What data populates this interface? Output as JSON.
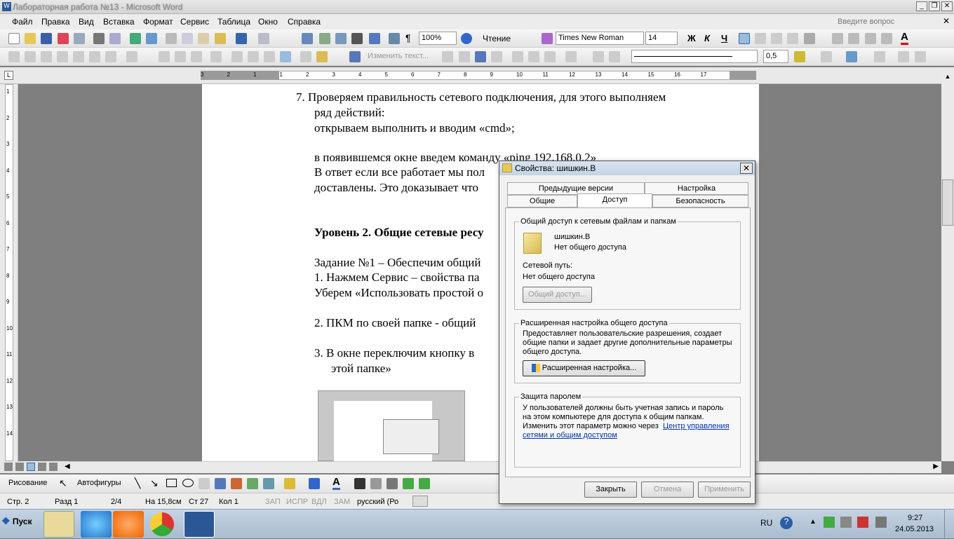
{
  "window": {
    "title": "Лабораторная работа №13 - Microsoft Word"
  },
  "menu": {
    "items": [
      "Файл",
      "Правка",
      "Вид",
      "Вставка",
      "Формат",
      "Сервис",
      "Таблица",
      "Окно",
      "Справка"
    ],
    "help_placeholder": "Введите вопрос"
  },
  "toolbar": {
    "zoom": "100%",
    "reading": "Чтение",
    "font": "Times New Roman",
    "size": "14",
    "bold": "Ж",
    "italic": "К",
    "underline": "Ч",
    "change_text": "Изменить текст...",
    "line_width": "0,5"
  },
  "ruler": {
    "marks": [
      "3",
      "2",
      "1",
      "1",
      "2",
      "3",
      "4",
      "5",
      "6",
      "7",
      "8",
      "9",
      "10",
      "11",
      "12",
      "13",
      "14",
      "15",
      "16",
      "17"
    ]
  },
  "document": {
    "lines": [
      "7.  Проверяем правильность сетевого подключения, для этого выполняем",
      "ряд действий:",
      "открываем выполнить и вводим «cmd»;",
      "в появившемся окне введем команду «ping 192.168.0.2»",
      "В ответ если все работает мы пол",
      "доставлены. Это доказывает что",
      "Уровень 2. Общие сетевые ресу",
      "Задание №1  – Обеспечим общий",
      "1.    Нажмем Сервис – свойства па",
      "Уберем «Использовать простой о",
      "2.   ПКМ по своей папке -  общий",
      "3.   В окне переключим кнопку в",
      "этой папке»"
    ]
  },
  "draw_toolbar": {
    "drawing": "Рисование",
    "autoshapes": "Автофигуры"
  },
  "status": {
    "page": "Стр. 2",
    "section": "Разд 1",
    "pages": "2/4",
    "at": "На 15,8см",
    "line": "Ст 27",
    "col": "Кол 1",
    "rec": "ЗАП",
    "trk": "ИСПР",
    "ext": "ВДЛ",
    "ovr": "ЗАМ",
    "lang": "русский (Ро"
  },
  "taskbar": {
    "start": "Пуск",
    "lang": "RU",
    "time": "9:27",
    "date": "24.05.2013"
  },
  "dialog": {
    "title": "Свойства: шишкин.В",
    "tabs_top": [
      "Предыдущие версии",
      "Настройка"
    ],
    "tabs_bottom": [
      "Общие",
      "Доступ",
      "Безопасность"
    ],
    "share_group": "Общий доступ к сетевым файлам и папкам",
    "folder_name": "шишкин.В",
    "folder_status": "Нет общего доступа",
    "net_path_label": "Сетевой путь:",
    "net_path_value": "Нет общего доступа",
    "share_button": "Общий доступ...",
    "adv_group": "Расширенная настройка общего доступа",
    "adv_text_1": "Предоставляет пользовательские разрешения, создает",
    "adv_text_2": "общие папки и задает другие дополнительные параметры",
    "adv_text_3": "общего доступа.",
    "adv_button": "Расширенная настройка...",
    "pwd_group": "Защита паролем",
    "pwd_text_1": "У пользователей должны быть учетная запись и пароль",
    "pwd_text_2": "на этом компьютере для доступа к общим папкам.",
    "pwd_text_3": "Изменить этот параметр можно через",
    "pwd_link_1": "Центр управления",
    "pwd_link_2": "сетями и общим доступом",
    "close_btn": "Закрыть",
    "cancel_btn": "Отмена",
    "apply_btn": "Применить"
  }
}
